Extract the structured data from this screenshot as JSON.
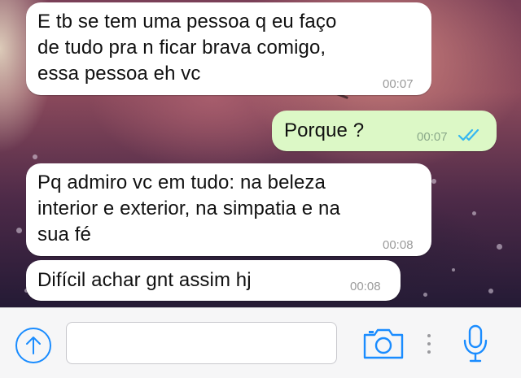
{
  "messages": [
    {
      "direction": "incoming",
      "text": "E tb se tem uma pessoa q eu faço\nde tudo pra n ficar brava comigo,\nessa pessoa eh vc",
      "time": "00:07"
    },
    {
      "direction": "outgoing",
      "text": "Porque ?",
      "time": "00:07",
      "status": "read-double-check-icon"
    },
    {
      "direction": "incoming",
      "text": "Pq admiro vc em tudo: na beleza\ninterior e exterior, na simpatia e na\nsua fé",
      "time": "00:08"
    },
    {
      "direction": "incoming",
      "text": "Difícil achar gnt assim hj",
      "time": "00:08"
    }
  ],
  "composer": {
    "input_value": "",
    "icons": [
      "upload-arrow-icon",
      "camera-icon",
      "more-dots-icon",
      "microphone-icon"
    ]
  },
  "colors": {
    "incoming_bubble": "#ffffff",
    "outgoing_bubble": "#dcf8c6",
    "accent": "#1a8cff",
    "read_ticks": "#34b7f1"
  }
}
